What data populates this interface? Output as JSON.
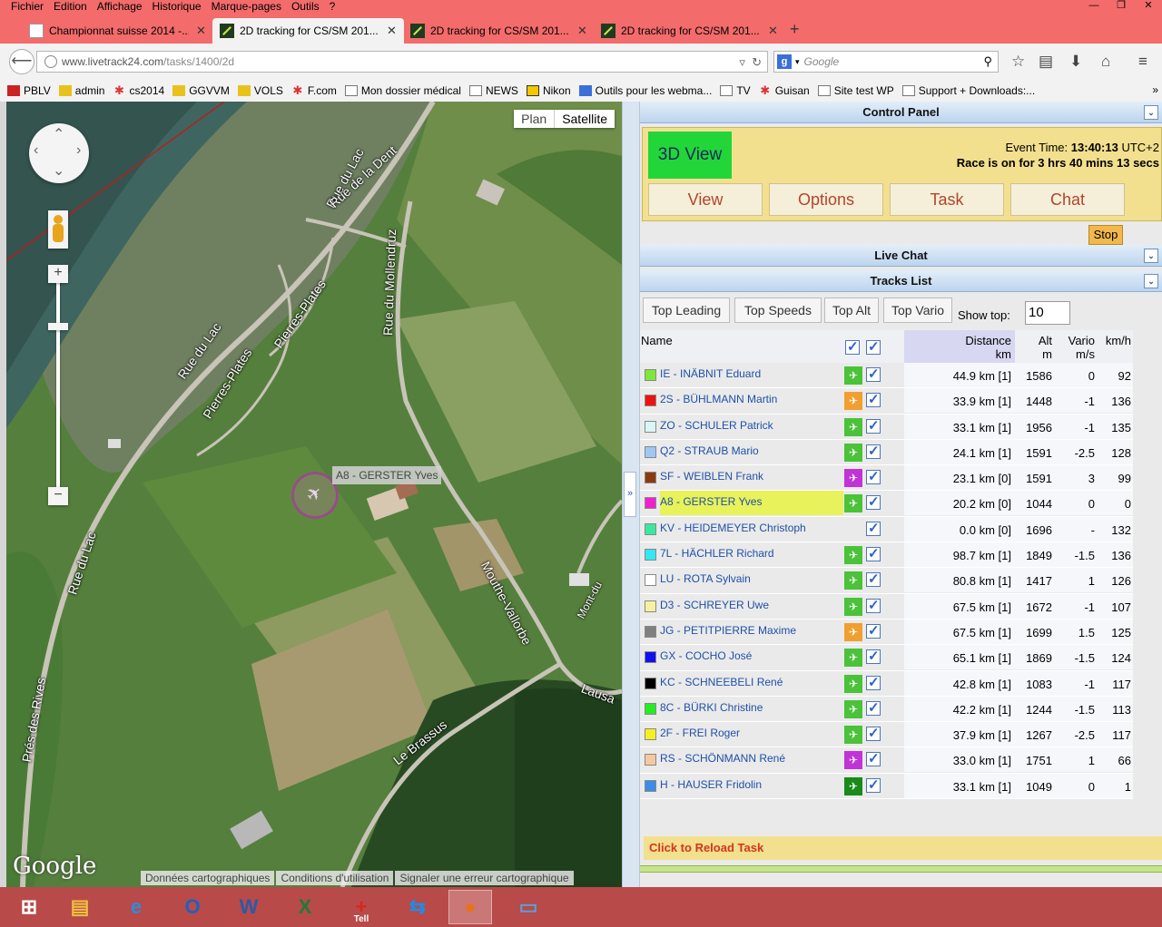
{
  "menu": [
    "Fichier",
    "Edition",
    "Affichage",
    "Historique",
    "Marque-pages",
    "Outils",
    "?"
  ],
  "tabs": [
    {
      "label": "Championnat suisse 2014 -...",
      "icon": "cs-favicon"
    },
    {
      "label": "2D tracking for CS/SM 201...",
      "icon": "livetrack-favicon"
    },
    {
      "label": "2D tracking for CS/SM 201...",
      "icon": "livetrack-favicon"
    },
    {
      "label": "2D tracking for CS/SM 201...",
      "icon": "livetrack-favicon"
    }
  ],
  "nav": {
    "url_host": "www.livetrack24.com",
    "url_path": "/tasks/1400/2d",
    "search_placeholder": "Google"
  },
  "bookmarks": [
    {
      "label": "PBLV",
      "icon": "red"
    },
    {
      "label": "admin",
      "icon": "yel"
    },
    {
      "label": "cs2014",
      "icon": "joom"
    },
    {
      "label": "GGVVM",
      "icon": "yel"
    },
    {
      "label": "VOLS",
      "icon": "yel"
    },
    {
      "label": "F.com",
      "icon": "joom"
    },
    {
      "label": "Mon dossier médical",
      "icon": "box"
    },
    {
      "label": "NEWS",
      "icon": "box"
    },
    {
      "label": "Nikon",
      "icon": "nik"
    },
    {
      "label": "Outils pour les webma...",
      "icon": "blue"
    },
    {
      "label": "TV",
      "icon": "box"
    },
    {
      "label": "Guisan",
      "icon": "joom"
    },
    {
      "label": "Site test WP",
      "icon": "box"
    },
    {
      "label": "Support + Downloads:...",
      "icon": "box"
    }
  ],
  "map": {
    "type_plan": "Plan",
    "type_satellite": "Satellite",
    "marker_label": "A8 - GERSTER Yves",
    "logo": "Google",
    "footer": [
      "Données cartographiques",
      "Conditions d'utilisation",
      "Signaler une erreur cartographique"
    ],
    "roads": [
      "Rue du Lac",
      "Rue de la Dent",
      "Rue du Mollendruz",
      "Rue du Lac",
      "Pierres-Plates",
      "Pierres-Plates",
      "Rue du Lac",
      "Prés des Rives",
      "Mouthe-Vallorbe",
      "Le Brassus",
      "Lausa",
      "Mont-du"
    ]
  },
  "panel": {
    "title": "Control Panel",
    "btn_3d": "3D View",
    "event_time_label": "Event Time:",
    "event_time": "13:40:13",
    "event_tz": "UTC+2",
    "race_status": "Race is on for 3 hrs 40 mins 13 secs",
    "buttons": [
      "View",
      "Options",
      "Task",
      "Chat"
    ],
    "stop": "Stop",
    "live_chat": "Live Chat",
    "tracks_list": "Tracks List",
    "list_tabs": [
      "Top Leading",
      "Top Speeds",
      "Top Alt",
      "Top Vario"
    ],
    "show_top_label": "Show top:",
    "show_top_value": "10",
    "col_name": "Name",
    "col_distance": "Distance",
    "col_distance_unit": "km",
    "col_alt": "Alt",
    "col_alt_unit": "m",
    "col_vario": "Vario",
    "col_vario_unit": "m/s",
    "col_kmh": "km/h",
    "reload": "Click to Reload Task"
  },
  "tracks": [
    {
      "name": "IE - INÄBNIT Eduard",
      "color": "#7ee83a",
      "icon": "#4bc23a",
      "dist": "44.9 km [1]",
      "alt": "1586",
      "vario": "0",
      "kmh": "92"
    },
    {
      "name": "2S - BÜHLMANN Martin",
      "color": "#ee1111",
      "icon": "#f0a030",
      "dist": "33.9 km [1]",
      "alt": "1448",
      "vario": "-1",
      "kmh": "136"
    },
    {
      "name": "ZO - SCHULER Patrick",
      "color": "#d8f6f6",
      "icon": "#4bc23a",
      "dist": "33.1 km [1]",
      "alt": "1956",
      "vario": "-1",
      "kmh": "135"
    },
    {
      "name": "Q2 - STRAUB Mario",
      "color": "#9ec8f2",
      "icon": "#4bc23a",
      "dist": "24.1 km [1]",
      "alt": "1591",
      "vario": "-2.5",
      "kmh": "128"
    },
    {
      "name": "SF - WEIBLEN Frank",
      "color": "#8b3a10",
      "icon": "#c033d6",
      "dist": "23.1 km [0]",
      "alt": "1591",
      "vario": "3",
      "kmh": "99"
    },
    {
      "name": "A8 - GERSTER Yves",
      "color": "#f020d0",
      "icon": "#4bc23a",
      "dist": "20.2 km [0]",
      "alt": "1044",
      "vario": "0",
      "kmh": "0",
      "highlight": true
    },
    {
      "name": "KV - HEIDEMEYER Christoph",
      "color": "#3ae8a0",
      "icon": "",
      "dist": "0.0 km [0]",
      "alt": "1696",
      "vario": "-",
      "kmh": "132"
    },
    {
      "name": "7L - HÄCHLER Richard",
      "color": "#33e8f2",
      "icon": "#4bc23a",
      "dist": "98.7 km [1]",
      "alt": "1849",
      "vario": "-1.5",
      "kmh": "136"
    },
    {
      "name": "LU - ROTA Sylvain",
      "color": "#ffffff",
      "icon": "#4bc23a",
      "dist": "80.8 km [1]",
      "alt": "1417",
      "vario": "1",
      "kmh": "126"
    },
    {
      "name": "D3 - SCHREYER Uwe",
      "color": "#f6f0a0",
      "icon": "#4bc23a",
      "dist": "67.5 km [1]",
      "alt": "1672",
      "vario": "-1",
      "kmh": "107"
    },
    {
      "name": "JG - PETITPIERRE Maxime",
      "color": "#808080",
      "icon": "#f0a030",
      "dist": "67.5 km [1]",
      "alt": "1699",
      "vario": "1.5",
      "kmh": "125"
    },
    {
      "name": "GX - COCHO José",
      "color": "#1111ee",
      "icon": "#4bc23a",
      "dist": "65.1 km [1]",
      "alt": "1869",
      "vario": "-1.5",
      "kmh": "124"
    },
    {
      "name": "KC - SCHNEEBELI René",
      "color": "#000000",
      "icon": "#4bc23a",
      "dist": "42.8 km [1]",
      "alt": "1083",
      "vario": "-1",
      "kmh": "117"
    },
    {
      "name": "8C - BÜRKI Christine",
      "color": "#22ee22",
      "icon": "#4bc23a",
      "dist": "42.2 km [1]",
      "alt": "1244",
      "vario": "-1.5",
      "kmh": "113"
    },
    {
      "name": "2F - FREI Roger",
      "color": "#f6f022",
      "icon": "#4bc23a",
      "dist": "37.9 km [1]",
      "alt": "1267",
      "vario": "-2.5",
      "kmh": "117"
    },
    {
      "name": "RS - SCHÖNMANN René",
      "color": "#f6c8a0",
      "icon": "#c033d6",
      "dist": "33.0 km [1]",
      "alt": "1751",
      "vario": "1",
      "kmh": "66"
    },
    {
      "name": "H - HAUSER Fridolin",
      "color": "#3a8ce8",
      "icon": "#1a8a1a",
      "dist": "33.1 km [1]",
      "alt": "1049",
      "vario": "0",
      "kmh": "1"
    }
  ],
  "taskbar": [
    {
      "name": "windows-start-icon",
      "glyph": "⊞",
      "color": "#ffffff"
    },
    {
      "name": "file-explorer-icon",
      "glyph": "▤",
      "color": "#f0c040"
    },
    {
      "name": "internet-explorer-icon",
      "glyph": "e",
      "color": "#2a8de0"
    },
    {
      "name": "outlook-icon",
      "glyph": "O",
      "color": "#1a62c0"
    },
    {
      "name": "word-icon",
      "glyph": "W",
      "color": "#2a5aa8"
    },
    {
      "name": "excel-icon",
      "glyph": "X",
      "color": "#1f7a3a"
    },
    {
      "name": "tell-icon",
      "glyph": "+",
      "color": "#d8261c",
      "label": "Tell"
    },
    {
      "name": "teamviewer-icon",
      "glyph": "⇆",
      "color": "#1f8ce6"
    },
    {
      "name": "firefox-icon",
      "glyph": "●",
      "color": "#e8721c",
      "active": true
    },
    {
      "name": "photos-icon",
      "glyph": "▭",
      "color": "#5aa0d8"
    }
  ]
}
